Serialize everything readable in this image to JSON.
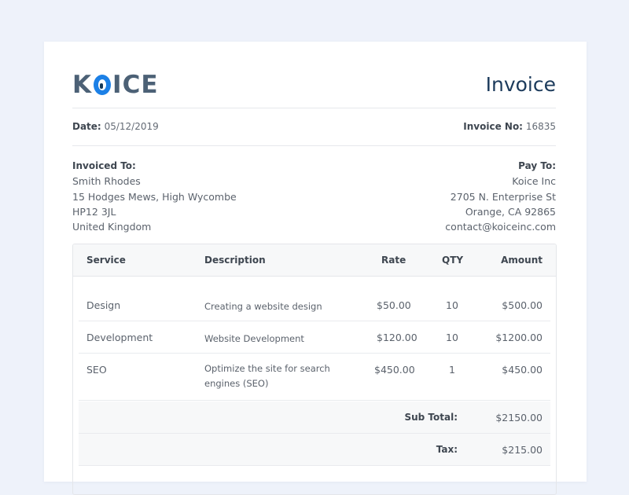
{
  "brand": {
    "logo_prefix": "K",
    "logo_suffix": "ICE",
    "accent": "#1c80e6"
  },
  "title": "Invoice",
  "meta": {
    "date_label": "Date:",
    "date_value": "05/12/2019",
    "invoice_no_label": "Invoice No:",
    "invoice_no_value": "16835"
  },
  "invoiced_to": {
    "heading": "Invoiced To:",
    "lines": [
      "Smith Rhodes",
      "15 Hodges Mews, High Wycombe",
      "HP12 3JL",
      "United Kingdom"
    ]
  },
  "pay_to": {
    "heading": "Pay To:",
    "lines": [
      "Koice Inc",
      "2705 N. Enterprise St",
      "Orange, CA 92865",
      "contact@koiceinc.com"
    ]
  },
  "table": {
    "headers": {
      "service": "Service",
      "description": "Description",
      "rate": "Rate",
      "qty": "QTY",
      "amount": "Amount"
    },
    "rows": [
      {
        "service": "Design",
        "description": "Creating a website design",
        "rate": "$50.00",
        "qty": "10",
        "amount": "$500.00"
      },
      {
        "service": "Development",
        "description": "Website Development",
        "rate": "$120.00",
        "qty": "10",
        "amount": "$1200.00"
      },
      {
        "service": "SEO",
        "description": "Optimize the site for search engines (SEO)",
        "rate": "$450.00",
        "qty": "1",
        "amount": "$450.00"
      }
    ],
    "subtotal_label": "Sub Total:",
    "subtotal_value": "$2150.00",
    "tax_label": "Tax:",
    "tax_value": "$215.00"
  }
}
